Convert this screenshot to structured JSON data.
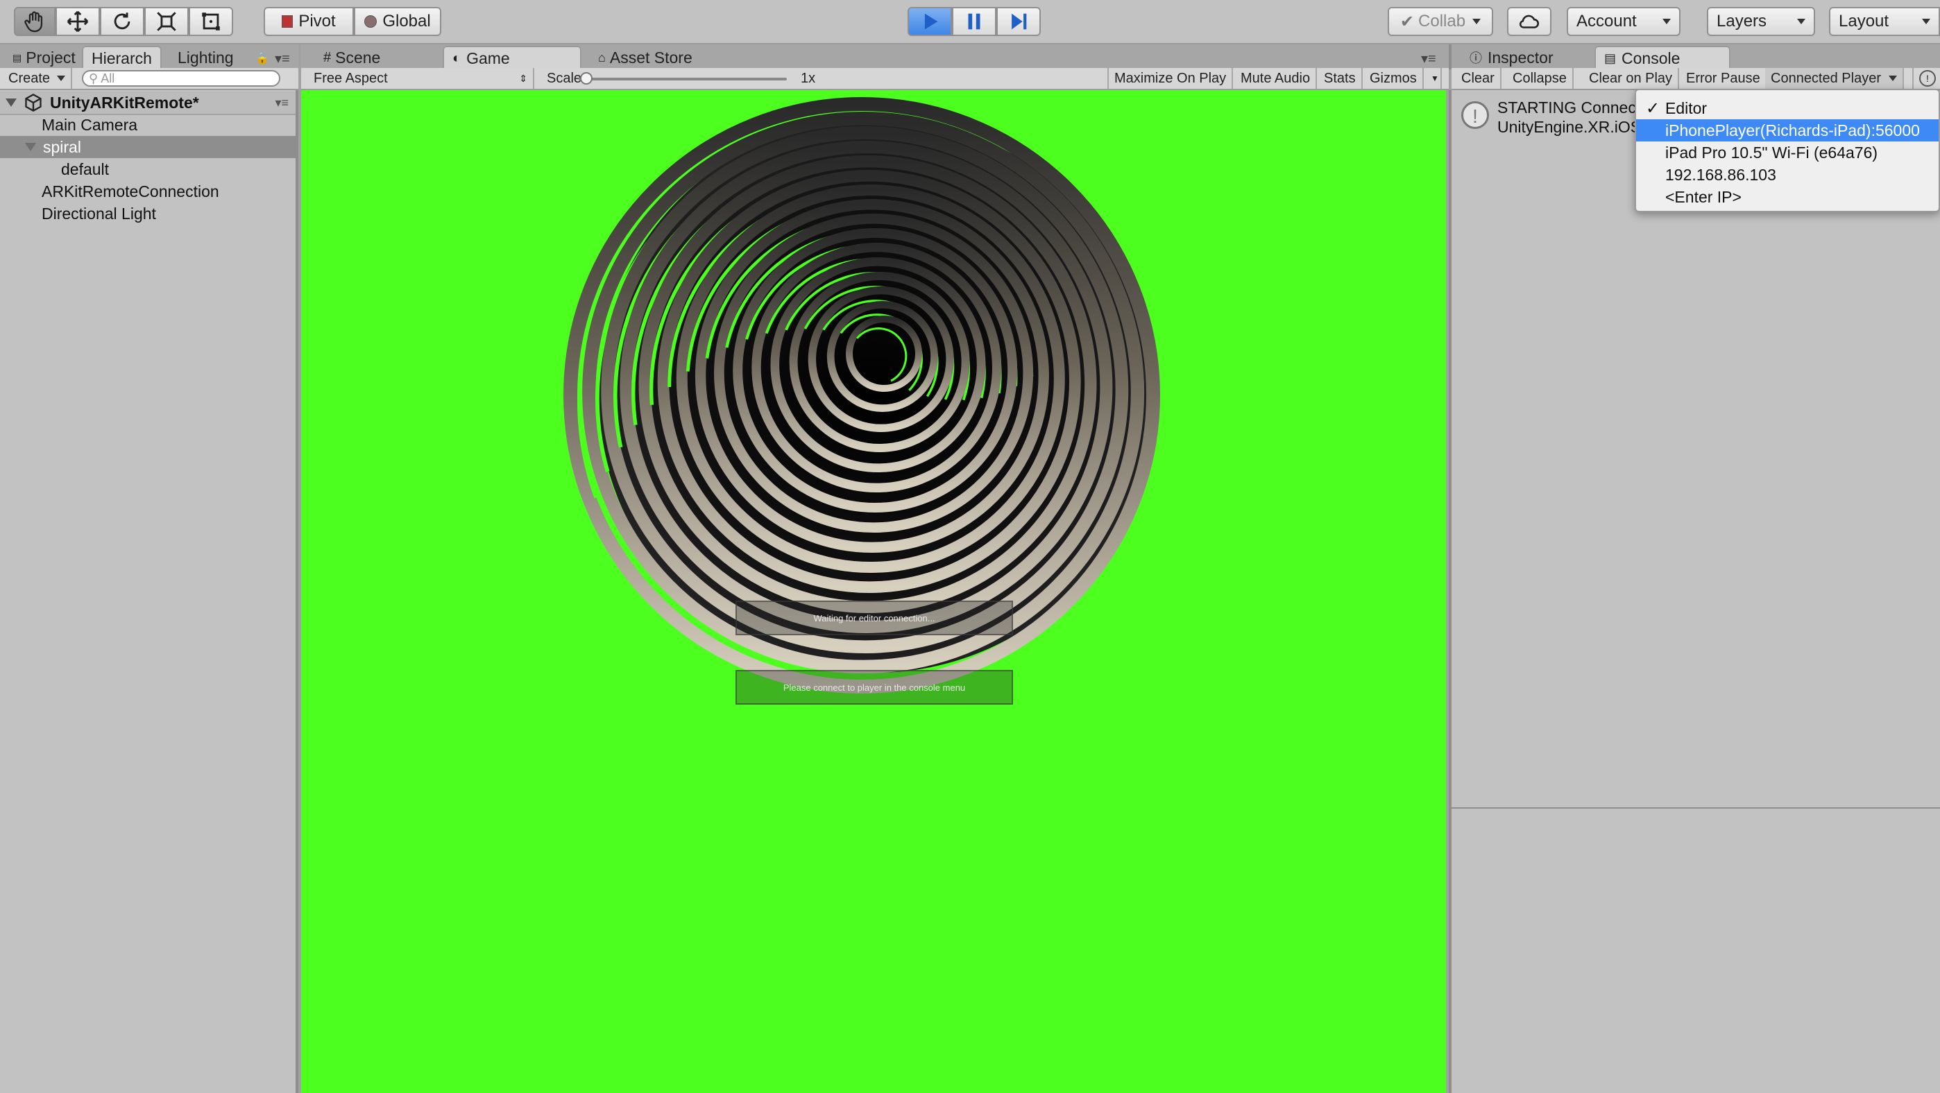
{
  "toolbar": {
    "pivot_label": "Pivot",
    "global_label": "Global",
    "collab_label": "Collab",
    "account_label": "Account",
    "layers_label": "Layers",
    "layout_label": "Layout",
    "tools": [
      "hand-icon",
      "move-icon",
      "rotate-icon",
      "scale-icon",
      "rect-tool-icon"
    ]
  },
  "left_panel": {
    "tabs": [
      {
        "label": "Project"
      },
      {
        "label": "Hierarch"
      },
      {
        "label": "Lighting"
      }
    ],
    "create_label": "Create",
    "search_placeholder": "All",
    "scene_name": "UnityARKitRemote*",
    "items": [
      {
        "label": "Main Camera"
      },
      {
        "label": "spiral"
      },
      {
        "label": "default"
      },
      {
        "label": "ARKitRemoteConnection"
      },
      {
        "label": "Directional Light"
      }
    ]
  },
  "center_panel": {
    "tabs": [
      {
        "label": "Scene"
      },
      {
        "label": "Game"
      },
      {
        "label": "Asset Store"
      }
    ],
    "aspect_label": "Free Aspect",
    "scale_label": "Scale",
    "scale_value": "1x",
    "maximize_label": "Maximize On Play",
    "mute_label": "Mute Audio",
    "stats_label": "Stats",
    "gizmos_label": "Gizmos",
    "viewport_bg": "#4cff1e",
    "overlay_waiting": "Waiting for editor connection...",
    "overlay_connect": "Please connect to player in the console menu"
  },
  "right_panel": {
    "tabs": [
      {
        "label": "Inspector"
      },
      {
        "label": "Console"
      }
    ],
    "clear_label": "Clear",
    "collapse_label": "Collapse",
    "clear_on_play_label": "Clear on Play",
    "error_pause_label": "Error Pause",
    "connected_player_label": "Connected Player",
    "log_line1": "STARTING Connect",
    "log_line2": "UnityEngine.XR.iOS",
    "menu": {
      "items": [
        {
          "label": "Editor",
          "checked": true
        },
        {
          "label": "iPhonePlayer(Richards-iPad):56000",
          "highlighted": true
        },
        {
          "label": "iPad Pro 10.5\" Wi-Fi (e64a76)"
        },
        {
          "label": "192.168.86.103"
        },
        {
          "label": "<Enter IP>"
        }
      ],
      "check_glyph": "✓"
    }
  },
  "colors": {
    "highlight": "#3d8af7",
    "play_accent": "#3f86e6",
    "viewport": "#4cff1e"
  }
}
